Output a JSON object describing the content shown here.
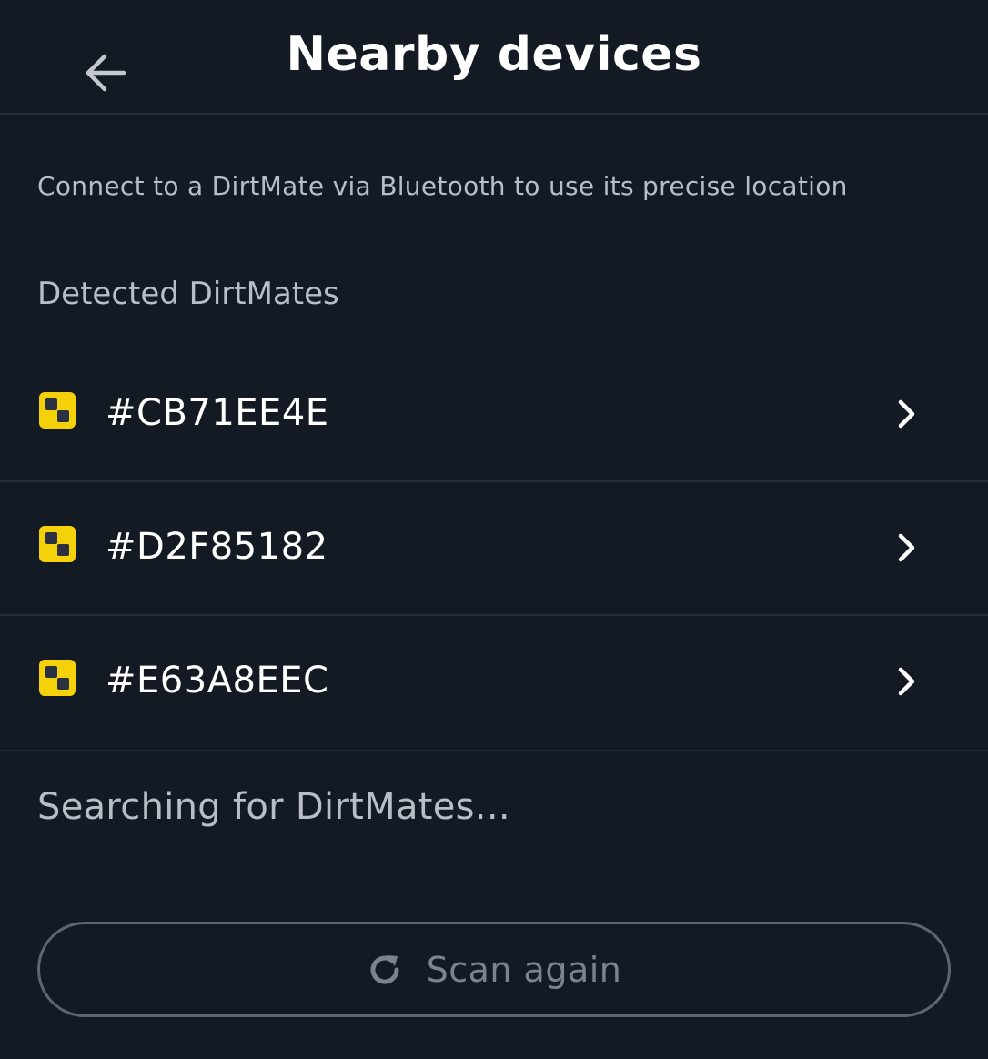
{
  "header": {
    "title": "Nearby devices",
    "back_icon": "arrow-left-icon"
  },
  "subtitle": "Connect to a DirtMate via Bluetooth to use its precise location",
  "section_label": "Detected DirtMates",
  "devices": [
    {
      "name": "#CB71EE4E",
      "icon": "dirtmate-icon"
    },
    {
      "name": "#D2F85182",
      "icon": "dirtmate-icon"
    },
    {
      "name": "#E63A8EEC",
      "icon": "dirtmate-icon"
    }
  ],
  "status_text": "Searching for DirtMates...",
  "scan_button": {
    "label": "Scan again",
    "icon": "refresh-icon"
  },
  "colors": {
    "background": "#141a24",
    "divider": "#252c38",
    "accent_yellow": "#f5d10a",
    "text_secondary": "#b8bdc6",
    "disabled": "#7d838d"
  }
}
